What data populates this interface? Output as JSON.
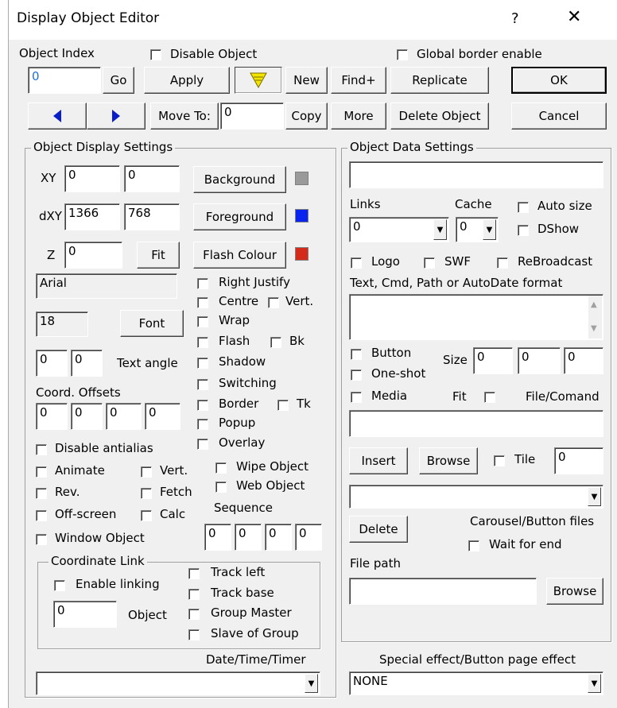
{
  "window": {
    "title": "Display Object Editor",
    "help": "?",
    "close": "✕"
  },
  "top": {
    "object_index_label": "Object Index",
    "disable_object_label": "Disable Object",
    "global_border_label": "Global border enable",
    "object_index_value": "0",
    "go": "Go",
    "apply": "Apply",
    "new": "New",
    "find": "Find+",
    "replicate": "Replicate",
    "ok": "OK",
    "move_to": "Move To:",
    "move_to_value": "0",
    "copy": "Copy",
    "more": "More",
    "delete_object": "Delete Object",
    "cancel": "Cancel"
  },
  "display": {
    "group_title": "Object Display Settings",
    "xy_label": "XY",
    "x": "0",
    "y": "0",
    "dxy_label": "dXY",
    "dx": "1366",
    "dy": "768",
    "z_label": "Z",
    "z": "0",
    "fit": "Fit",
    "background": "Background",
    "foreground": "Foreground",
    "flash_colour": "Flash Colour",
    "bg_color": "#9a9a9a",
    "fg_color": "#0a24f0",
    "flash_color": "#d42a1a",
    "font_name": "Arial",
    "font_size": "18",
    "font_button": "Font",
    "angle_a": "0",
    "angle_b": "0",
    "text_angle": "Text angle",
    "coord_offsets": "Coord. Offsets",
    "off1": "0",
    "off2": "0",
    "off3": "0",
    "off4": "0",
    "right_justify": "Right Justify",
    "centre": "Centre",
    "vert": "Vert.",
    "wrap": "Wrap",
    "flash": "Flash",
    "bk": "Bk",
    "shadow": "Shadow",
    "switching": "Switching",
    "border": "Border",
    "tk": "Tk",
    "popup": "Popup",
    "overlay": "Overlay",
    "wipe_object": "Wipe Object",
    "web_object": "Web Object",
    "disable_antialias": "Disable antialias",
    "animate": "Animate",
    "vert2": "Vert.",
    "rev": "Rev.",
    "fetch": "Fetch",
    "off_screen": "Off-screen",
    "calc": "Calc",
    "window_object": "Window Object",
    "sequence": "Sequence",
    "seq1": "0",
    "seq2": "0",
    "seq3": "0",
    "seq4": "0",
    "coord_link": "Coordinate Link",
    "enable_linking": "Enable linking",
    "link_object_value": "0",
    "object": "Object",
    "track_left": "Track left",
    "track_base": "Track base",
    "group_master": "Group Master",
    "slave_of_group": "Slave of Group",
    "date_time_timer": "Date/Time/Timer",
    "date_time_value": ""
  },
  "data": {
    "group_title": "Object Data Settings",
    "top_text": "",
    "links": "Links",
    "links_value": "0",
    "cache": "Cache",
    "cache_value": "0",
    "auto_size": "Auto size",
    "dshow": "DShow",
    "logo": "Logo",
    "swf": "SWF",
    "rebroadcast": "ReBroadcast",
    "text_format_label": "Text, Cmd, Path or AutoDate format",
    "text_format_value": "",
    "button": "Button",
    "size": "Size",
    "size1": "0",
    "size2": "0",
    "size3": "0",
    "one_shot": "One-shot",
    "media": "Media",
    "fit": "Fit",
    "file_command": "File/Comand",
    "file_value": "",
    "insert": "Insert",
    "browse": "Browse",
    "tile": "Tile",
    "tile_value": "0",
    "carousel_value": "",
    "delete": "Delete",
    "carousel_label": "Carousel/Button files",
    "wait_for_end": "Wait for end",
    "file_path": "File path",
    "file_path_value": "",
    "browse2": "Browse",
    "special_effect_label": "Special effect/Button page effect",
    "special_effect_value": "NONE"
  }
}
